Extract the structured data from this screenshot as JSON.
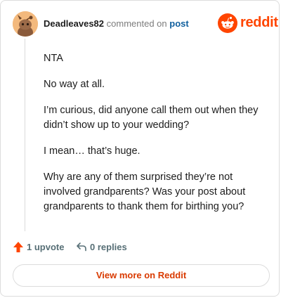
{
  "header": {
    "username": "Deadleaves82",
    "commented_text": "commented on",
    "post_link": "post",
    "brand_word": "reddit"
  },
  "comment": {
    "paragraphs": [
      "NTA",
      "No way at all.",
      "I’m curious, did anyone call them out when they didn’t show up to your wedding?",
      "I mean… that’s huge.",
      "Why are any of them surprised they’re not involved grandparents? Was your post about grandparents to thank them for birthing you?"
    ]
  },
  "actions": {
    "upvote_label": "1 upvote",
    "reply_label": "0 replies"
  },
  "footer": {
    "view_more_label": "View more on Reddit"
  },
  "colors": {
    "brand": "#ff4500",
    "link": "#0f5f9e",
    "button_text": "#d93a00",
    "upvote_arrow": "#ff4500"
  },
  "icons": {
    "avatar": "snoo-avatar-icon",
    "brand": "reddit-logo-icon",
    "upvote": "upvote-arrow-icon",
    "reply": "reply-arrow-icon"
  }
}
